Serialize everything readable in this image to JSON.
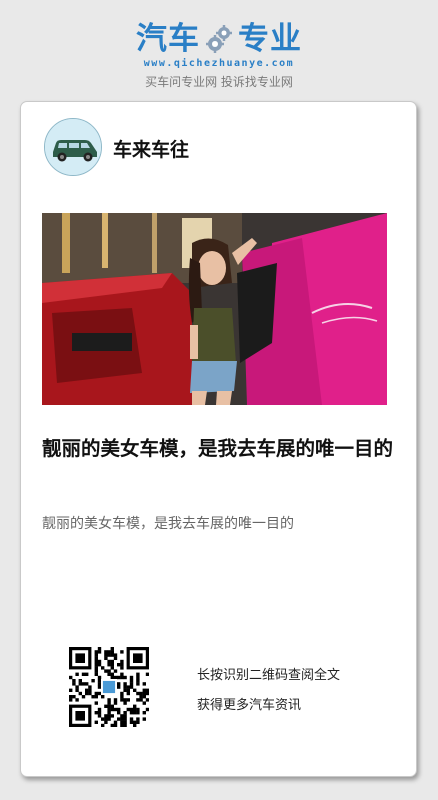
{
  "header": {
    "logo_left": "汽车",
    "logo_right": "专业",
    "domain": "www.qichezhuanye.com",
    "slogan": "买车问专业网 投诉找专业网",
    "brand_color": "#2a7fc6"
  },
  "author": {
    "avatar_icon": "car-icon",
    "name": "车来车往"
  },
  "article": {
    "image_desc_icon": "photo",
    "title": "靓丽的美女车模，是我去车展的唯一目的",
    "summary": "靓丽的美女车模，是我去车展的唯一目的"
  },
  "qr": {
    "icon": "qr-code-icon",
    "line1": "长按识别二维码查阅全文",
    "line2": "获得更多汽车资讯"
  }
}
